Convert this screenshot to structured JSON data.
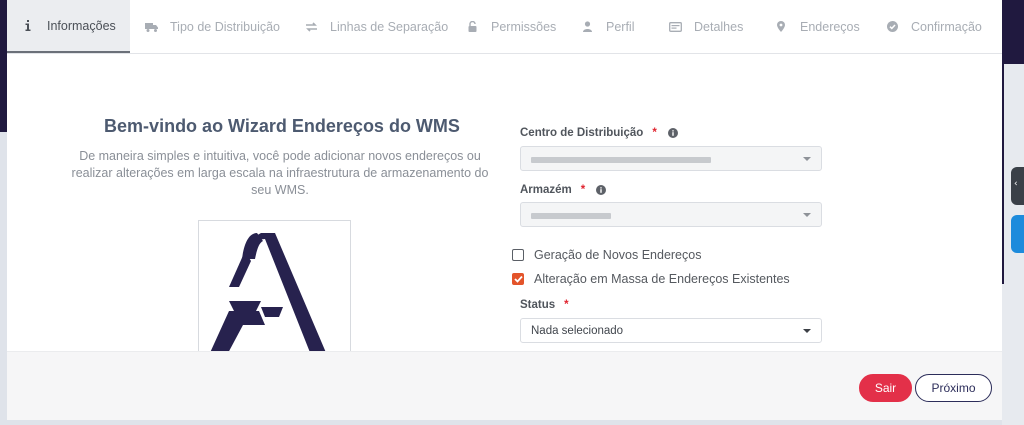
{
  "wizard": {
    "steps": [
      {
        "label": "Informações",
        "icon": "info-icon",
        "active": true
      },
      {
        "label": "Tipo de Distribuição",
        "icon": "truck-icon",
        "active": false
      },
      {
        "label": "Linhas de Separação",
        "icon": "exchange-icon",
        "active": false
      },
      {
        "label": "Permissões",
        "icon": "lock-icon",
        "active": false
      },
      {
        "label": "Perfil",
        "icon": "user-icon",
        "active": false
      },
      {
        "label": "Detalhes",
        "icon": "card-icon",
        "active": false
      },
      {
        "label": "Endereços",
        "icon": "map-marker-icon",
        "active": false
      },
      {
        "label": "Confirmação",
        "icon": "check-circle-icon",
        "active": false
      }
    ]
  },
  "intro": {
    "title": "Bem-vindo ao Wizard Endereços do WMS",
    "text": "De maneira simples e intuitiva, você pode adicionar novos endereços ou realizar alterações em larga escala na infraestrutura de armazenamento do seu WMS."
  },
  "form": {
    "distribution_center": {
      "label": "Centro de Distribuição",
      "required_mark": "*"
    },
    "warehouse": {
      "label": "Armazém",
      "required_mark": "*"
    },
    "options": [
      {
        "label": "Geração de Novos Endereços",
        "checked": false
      },
      {
        "label": "Alteração em Massa de Endereços Existentes",
        "checked": true
      }
    ],
    "status": {
      "label": "Status",
      "required_mark": "*",
      "value": "Nada selecionado"
    }
  },
  "footer": {
    "exit_label": "Sair",
    "next_label": "Próximo"
  },
  "colors": {
    "header_band": "#20193f",
    "danger": "#e33049",
    "checkbox_accent": "#e3542a",
    "brand_navy": "#2c2d5a"
  }
}
